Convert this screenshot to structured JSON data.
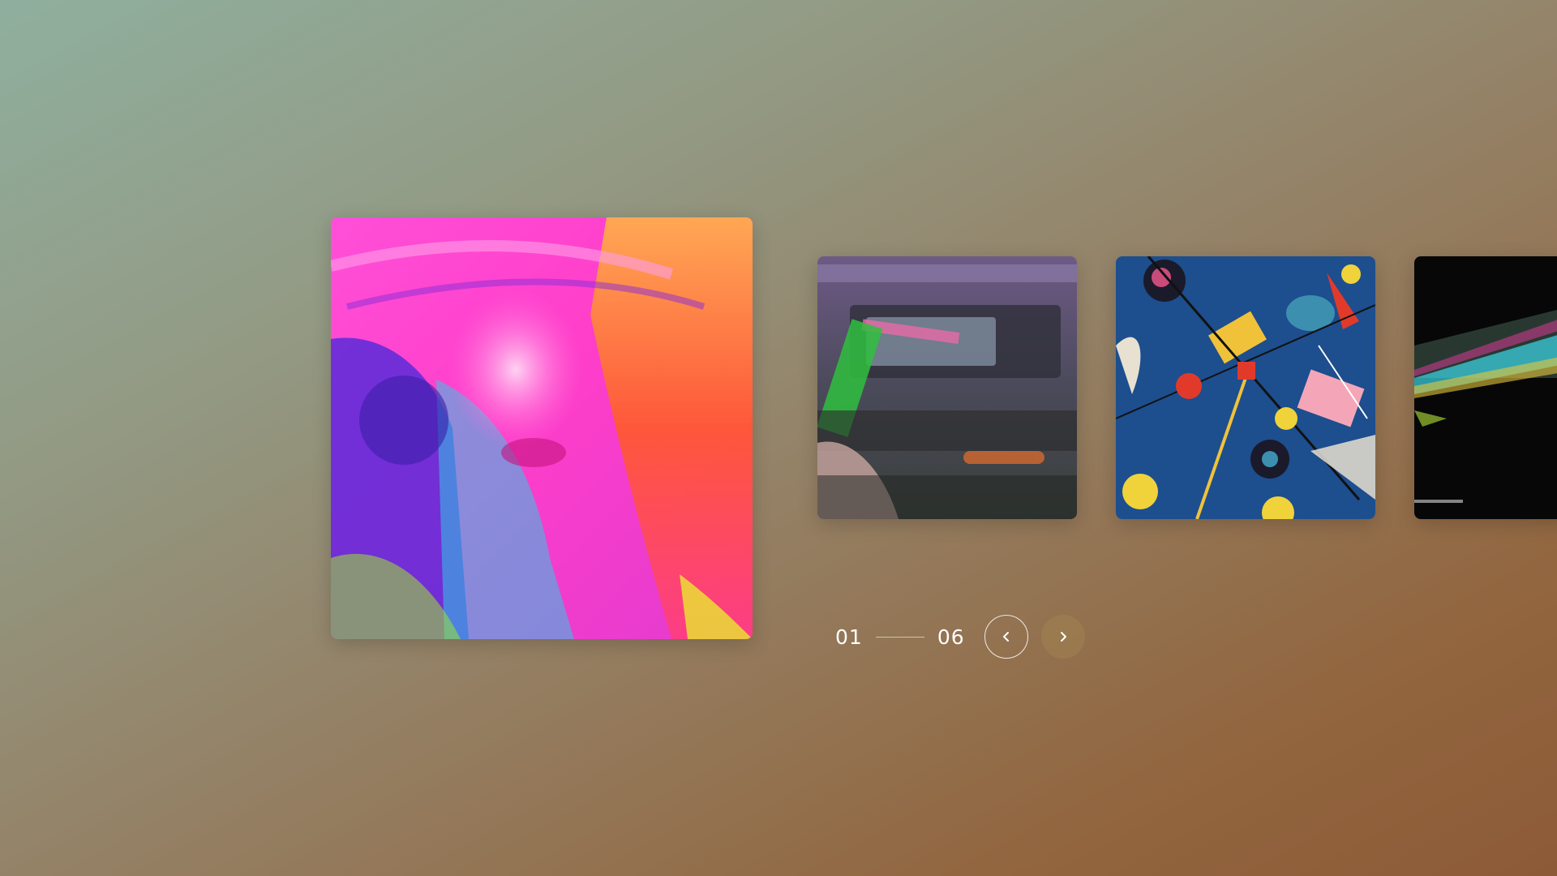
{
  "carousel": {
    "slides": [
      {
        "name": "slide-neon-portrait",
        "icon": "portrait-image"
      },
      {
        "name": "slide-cassette-player",
        "icon": "cassette-image"
      },
      {
        "name": "slide-abstract-geometry",
        "icon": "abstract-art-image"
      },
      {
        "name": "slide-light-streaks",
        "icon": "light-streak-image"
      }
    ],
    "counter": {
      "current": "01",
      "total": "06"
    },
    "controls": {
      "prev_icon": "chevron-left-icon",
      "next_icon": "chevron-right-icon"
    }
  },
  "colors": {
    "accent": "#ffffff",
    "next_button_fill": "#a08250"
  }
}
